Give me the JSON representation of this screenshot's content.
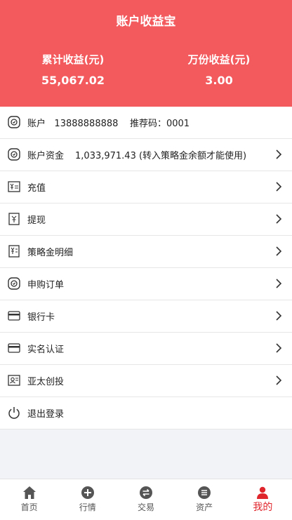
{
  "header": {
    "title": "账户收益宝",
    "total_income_label": "累计收益(元)",
    "total_income_value": "55,067.02",
    "per_10k_label": "万份收益(元)",
    "per_10k_value": "3.00"
  },
  "menu": {
    "account": {
      "label": "账户",
      "number": "13888888888",
      "referral_label": "推荐码：",
      "referral_code": "0001",
      "icon": "account-icon"
    },
    "funds": {
      "label": "账户资金",
      "value": "1,033,971.43 (转入策略金余额才能使用)",
      "icon": "wallet-icon"
    },
    "recharge": {
      "label": "充值",
      "icon": "yen-card-icon"
    },
    "withdraw": {
      "label": "提现",
      "icon": "withdraw-icon"
    },
    "strategy": {
      "label": "策略金明细",
      "icon": "document-yen-icon"
    },
    "orders": {
      "label": "申购订单",
      "icon": "order-icon"
    },
    "bankcard": {
      "label": "银行卡",
      "icon": "card-icon"
    },
    "realname": {
      "label": "实名认证",
      "icon": "id-card-icon"
    },
    "asia": {
      "label": "亚太创投",
      "icon": "profile-card-icon"
    },
    "logout": {
      "label": "退出登录",
      "icon": "power-icon"
    }
  },
  "tabs": {
    "home": "首页",
    "market": "行情",
    "trade": "交易",
    "assets": "资产",
    "mine": "我的"
  },
  "colors": {
    "header_bg": "#f25a5e",
    "active_tab": "#e0262d",
    "divider": "#e6e6e6"
  }
}
